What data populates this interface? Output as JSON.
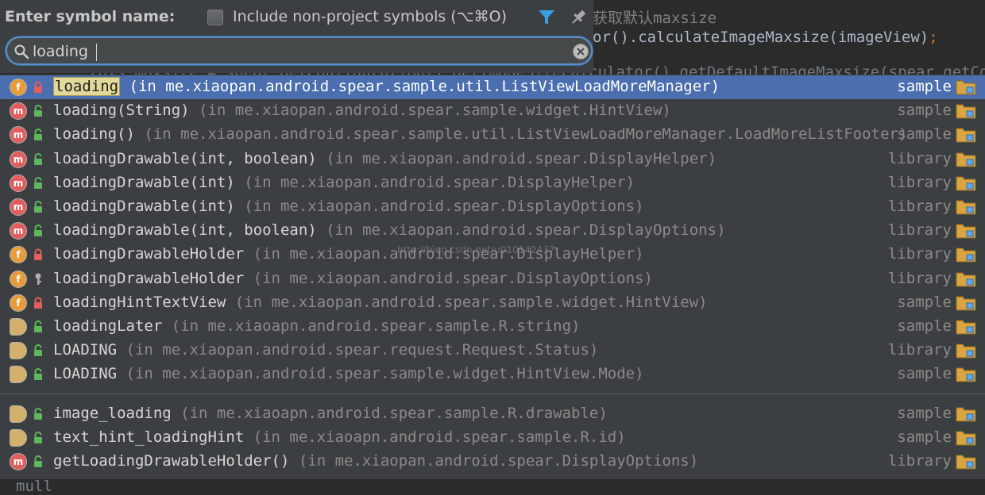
{
  "editor": {
    "comment": "获取默认maxsize",
    "code_line_prefix": "or().calculateImageMaxsize(imageView)",
    "code_semicolon": ";",
    "code_line_behind": "this.maxsize = spear.getConfiguration().getImageSizeCalculator().getDefaultImageMaxsize(spear.getCont",
    "code_line_bottom": "mull"
  },
  "header": {
    "title": "Enter symbol name:",
    "include_label": "Include non-project symbols (⌥⌘O)",
    "include_checked": false
  },
  "search": {
    "value": "loading",
    "placeholder": ""
  },
  "watermark": "http://blog.csdn.net/u010142437",
  "results": [
    {
      "kind": "field",
      "kind_letter": "f",
      "visibility": "private",
      "name": "loading",
      "match": true,
      "location": "(in me.xiaopan.android.spear.sample.util.ListViewLoadMoreManager)",
      "module": "sample",
      "selected": true
    },
    {
      "kind": "method",
      "kind_letter": "m",
      "visibility": "public",
      "name": "loading(String)",
      "match": false,
      "location": "(in me.xiaopan.android.spear.sample.widget.HintView)",
      "module": "sample",
      "selected": false
    },
    {
      "kind": "method",
      "kind_letter": "m",
      "visibility": "public",
      "name": "loading()",
      "match": false,
      "location": "(in me.xiaopan.android.spear.sample.util.ListViewLoadMoreManager.LoadMoreListFooter)",
      "module": "sample",
      "selected": false
    },
    {
      "kind": "method",
      "kind_letter": "m",
      "visibility": "public",
      "name": "loadingDrawable(int, boolean)",
      "match": false,
      "location": "(in me.xiaopan.android.spear.DisplayHelper)",
      "module": "library",
      "selected": false
    },
    {
      "kind": "method",
      "kind_letter": "m",
      "visibility": "public",
      "name": "loadingDrawable(int)",
      "match": false,
      "location": "(in me.xiaopan.android.spear.DisplayHelper)",
      "module": "library",
      "selected": false
    },
    {
      "kind": "method",
      "kind_letter": "m",
      "visibility": "public",
      "name": "loadingDrawable(int)",
      "match": false,
      "location": "(in me.xiaopan.android.spear.DisplayOptions)",
      "module": "library",
      "selected": false
    },
    {
      "kind": "method",
      "kind_letter": "m",
      "visibility": "public",
      "name": "loadingDrawable(int, boolean)",
      "match": false,
      "location": "(in me.xiaopan.android.spear.DisplayOptions)",
      "module": "library",
      "selected": false
    },
    {
      "kind": "field",
      "kind_letter": "f",
      "visibility": "private",
      "name": "loadingDrawableHolder",
      "match": false,
      "location": "(in me.xiaopan.android.spear.DisplayHelper)",
      "module": "library",
      "selected": false
    },
    {
      "kind": "field",
      "kind_letter": "f",
      "visibility": "package",
      "name": "loadingDrawableHolder",
      "match": false,
      "location": "(in me.xiaopan.android.spear.DisplayOptions)",
      "module": "library",
      "selected": false
    },
    {
      "kind": "field",
      "kind_letter": "f",
      "visibility": "private",
      "name": "loadingHintTextView",
      "match": false,
      "location": "(in me.xiaopan.android.spear.sample.widget.HintView)",
      "module": "sample",
      "selected": false
    },
    {
      "kind": "res",
      "kind_letter": "",
      "visibility": "public",
      "name": "loadingLater",
      "match": false,
      "location": "(in me.xiaoapn.android.spear.sample.R.string)",
      "module": "sample",
      "selected": false
    },
    {
      "kind": "res",
      "kind_letter": "",
      "visibility": "public",
      "name": "LOADING",
      "match": false,
      "location": "(in me.xiaopan.android.spear.request.Request.Status)",
      "module": "library",
      "selected": false
    },
    {
      "kind": "res",
      "kind_letter": "",
      "visibility": "public",
      "name": "LOADING",
      "match": false,
      "location": "(in me.xiaopan.android.spear.sample.widget.HintView.Mode)",
      "module": "sample",
      "selected": false
    },
    {
      "kind": "res",
      "kind_letter": "",
      "visibility": "public",
      "name": "image_loading",
      "match": false,
      "location": "(in me.xiaoapn.android.spear.sample.R.drawable)",
      "module": "sample",
      "selected": false
    },
    {
      "kind": "res",
      "kind_letter": "",
      "visibility": "public",
      "name": "text_hint_loadingHint",
      "match": false,
      "location": "(in me.xiaoapn.android.spear.sample.R.id)",
      "module": "sample",
      "selected": false
    },
    {
      "kind": "method",
      "kind_letter": "m",
      "visibility": "public",
      "name": "getLoadingDrawableHolder()",
      "match": false,
      "location": "(in me.xiaopan.android.spear.DisplayOptions)",
      "module": "library",
      "selected": false
    }
  ],
  "colors": {
    "selection": "#4b6eaf",
    "filter_icon": "#3d9ee8",
    "lock_private": "#e25d5d",
    "lock_public": "#5fb65f",
    "folder": "#d9a441"
  },
  "icons": {
    "filter": "filter-icon",
    "pin": "pin-icon",
    "search": "search-icon",
    "clear": "clear-icon",
    "folder": "folder-icon"
  }
}
